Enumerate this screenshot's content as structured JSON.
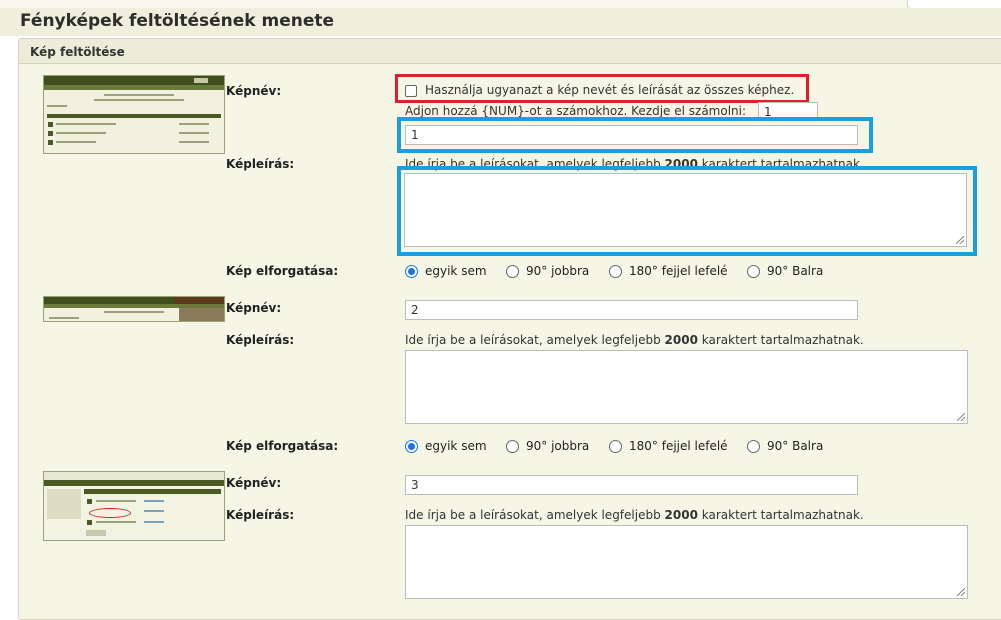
{
  "page": {
    "title": "Fényképek feltöltésének menete"
  },
  "panel": {
    "title": "Kép feltöltése"
  },
  "form": {
    "same_name_checkbox_label": "Használja ugyanazt a kép nevét és leírását az összes képhez.",
    "num_hint": "Adjon hozzá {NUM}-ot a számokhoz. Kezdje el számolni:",
    "num_start_value": "1",
    "labels": {
      "name": "Képnév:",
      "description": "Képleírás:",
      "rotation": "Kép elforgatása:"
    },
    "description_hint_prefix": "Ide írja be a leírásokat, amelyek legfeljebb",
    "description_hint_limit": "2000",
    "description_hint_suffix": "karaktert tartalmazhatnak.",
    "rotation_options": [
      "egyik sem",
      "90° jobbra",
      "180° fejjel lefelé",
      "90° Balra"
    ],
    "images": [
      {
        "name": "1",
        "description": "",
        "rotation_selected": "egyik sem"
      },
      {
        "name": "2",
        "description": "",
        "rotation_selected": "egyik sem"
      },
      {
        "name": "3",
        "description": "",
        "rotation_selected": "egyik sem"
      }
    ]
  },
  "highlight_colors": {
    "red": "#e01f2a",
    "blue": "#1ba0dd"
  }
}
